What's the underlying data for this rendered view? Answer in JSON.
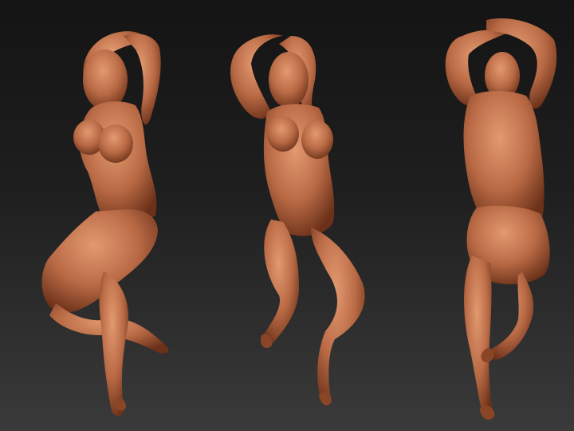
{
  "scene": {
    "background_top": "#141414",
    "background_bottom": "#3a3a3a",
    "clay_color": "#b96a45",
    "clay_shadow": "#5a2a14",
    "clay_highlight": "#e39a70"
  },
  "views": [
    {
      "name": "three-quarter-front-view"
    },
    {
      "name": "front-view"
    },
    {
      "name": "back-view"
    }
  ]
}
